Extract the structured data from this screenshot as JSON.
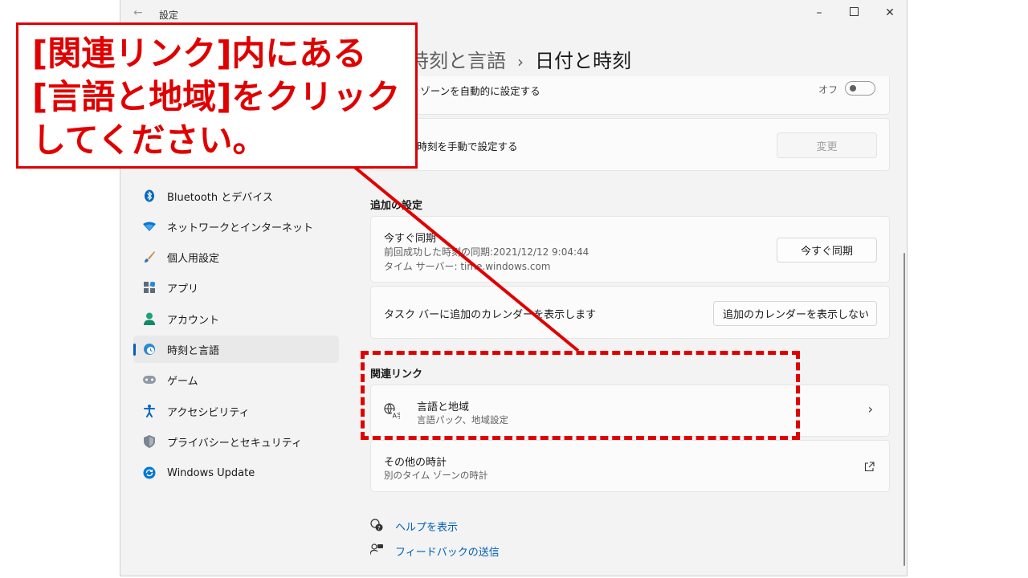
{
  "window": {
    "title": "設定"
  },
  "breadcrumb": {
    "parent": "時刻と言語",
    "current": "日付と時刻"
  },
  "sidebar": {
    "items": [
      {
        "label": "Bluetooth とデバイス",
        "icon": "bluetooth-icon"
      },
      {
        "label": "ネットワークとインターネット",
        "icon": "wifi-icon"
      },
      {
        "label": "個人用設定",
        "icon": "brush-icon"
      },
      {
        "label": "アプリ",
        "icon": "apps-icon"
      },
      {
        "label": "アカウント",
        "icon": "account-icon"
      },
      {
        "label": "時刻と言語",
        "icon": "globe-clock-icon",
        "active": true
      },
      {
        "label": "ゲーム",
        "icon": "gamepad-icon"
      },
      {
        "label": "アクセシビリティ",
        "icon": "accessibility-icon"
      },
      {
        "label": "プライバシーとセキュリティ",
        "icon": "shield-icon"
      },
      {
        "label": "Windows Update",
        "icon": "update-icon"
      }
    ]
  },
  "main": {
    "timezone_auto": {
      "label": "タイム ゾーンを自動的に設定する",
      "state": "オフ"
    },
    "manual_time": {
      "label": "日付と時刻を手動で設定する",
      "button": "変更"
    },
    "additional": {
      "header": "追加の設定",
      "sync": {
        "title": "今すぐ同期",
        "last_sync": "前回成功した時刻の同期:2021/12/12 9:04:44",
        "server": "タイム サーバー: time.windows.com",
        "button": "今すぐ同期"
      },
      "calendar": {
        "label": "タスク バーに追加のカレンダーを表示します",
        "selected": "追加のカレンダーを表示しない"
      }
    },
    "related": {
      "header": "関連リンク",
      "language_region": {
        "title": "言語と地域",
        "subtitle": "言語パック、地域設定"
      },
      "other_clocks": {
        "title": "その他の時計",
        "subtitle": "別のタイム ゾーンの時計"
      }
    },
    "footer": {
      "help": "ヘルプを表示",
      "feedback": "フィードバックの送信"
    }
  },
  "annotation": {
    "lines": [
      "[関連リンク]内にある",
      "[言語と地域]をクリック",
      "してください。"
    ],
    "color": "#e00000"
  },
  "colors": {
    "accent": "#005fb8",
    "window_bg": "#f3f3f3",
    "card_bg": "#fbfbfb"
  }
}
